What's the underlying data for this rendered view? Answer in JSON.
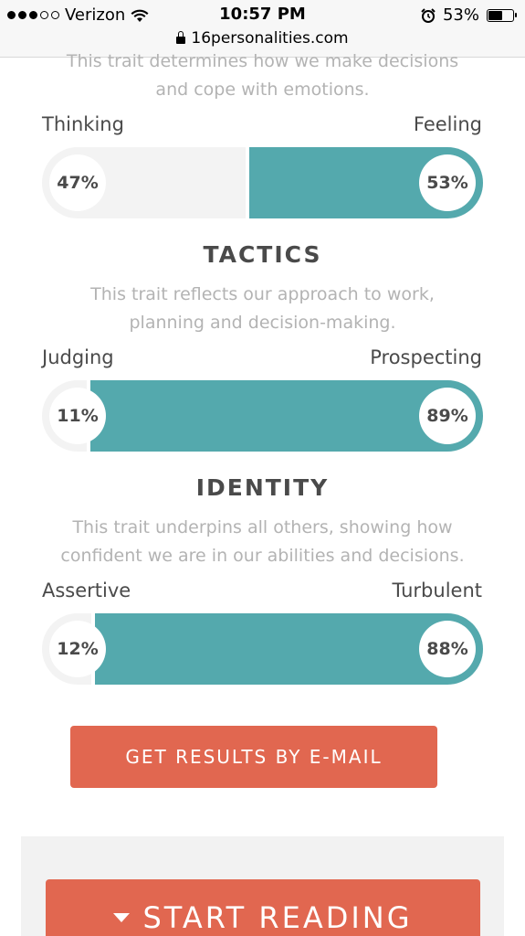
{
  "status_bar": {
    "carrier": "Verizon",
    "signal_bars": 3,
    "signal_total": 5,
    "time": "10:57 PM",
    "battery": "53%",
    "battery_level": 0.53,
    "url": "16personalities.com"
  },
  "colors": {
    "teal": "#54a9ad",
    "coral": "#e16750",
    "track": "#f3f3f3"
  },
  "nature": {
    "description_line1": "This trait determines how we make decisions",
    "description_line2": "and cope with emotions.",
    "left_label": "Thinking",
    "right_label": "Feeling",
    "left_pct": "47%",
    "right_pct": "53%",
    "right_value": 53
  },
  "tactics": {
    "heading": "TACTICS",
    "description_line1": "This trait reflects our approach to work,",
    "description_line2": "planning and decision-making.",
    "left_label": "Judging",
    "right_label": "Prospecting",
    "left_pct": "11%",
    "right_pct": "89%",
    "right_value": 89
  },
  "identity": {
    "heading": "IDENTITY",
    "description_line1": "This trait underpins all others, showing how",
    "description_line2": "confident we are in our abilities and decisions.",
    "left_label": "Assertive",
    "right_label": "Turbulent",
    "left_pct": "12%",
    "right_pct": "88%",
    "right_value": 88
  },
  "buttons": {
    "email": "GET RESULTS BY E-MAIL",
    "start_reading": "START READING"
  }
}
